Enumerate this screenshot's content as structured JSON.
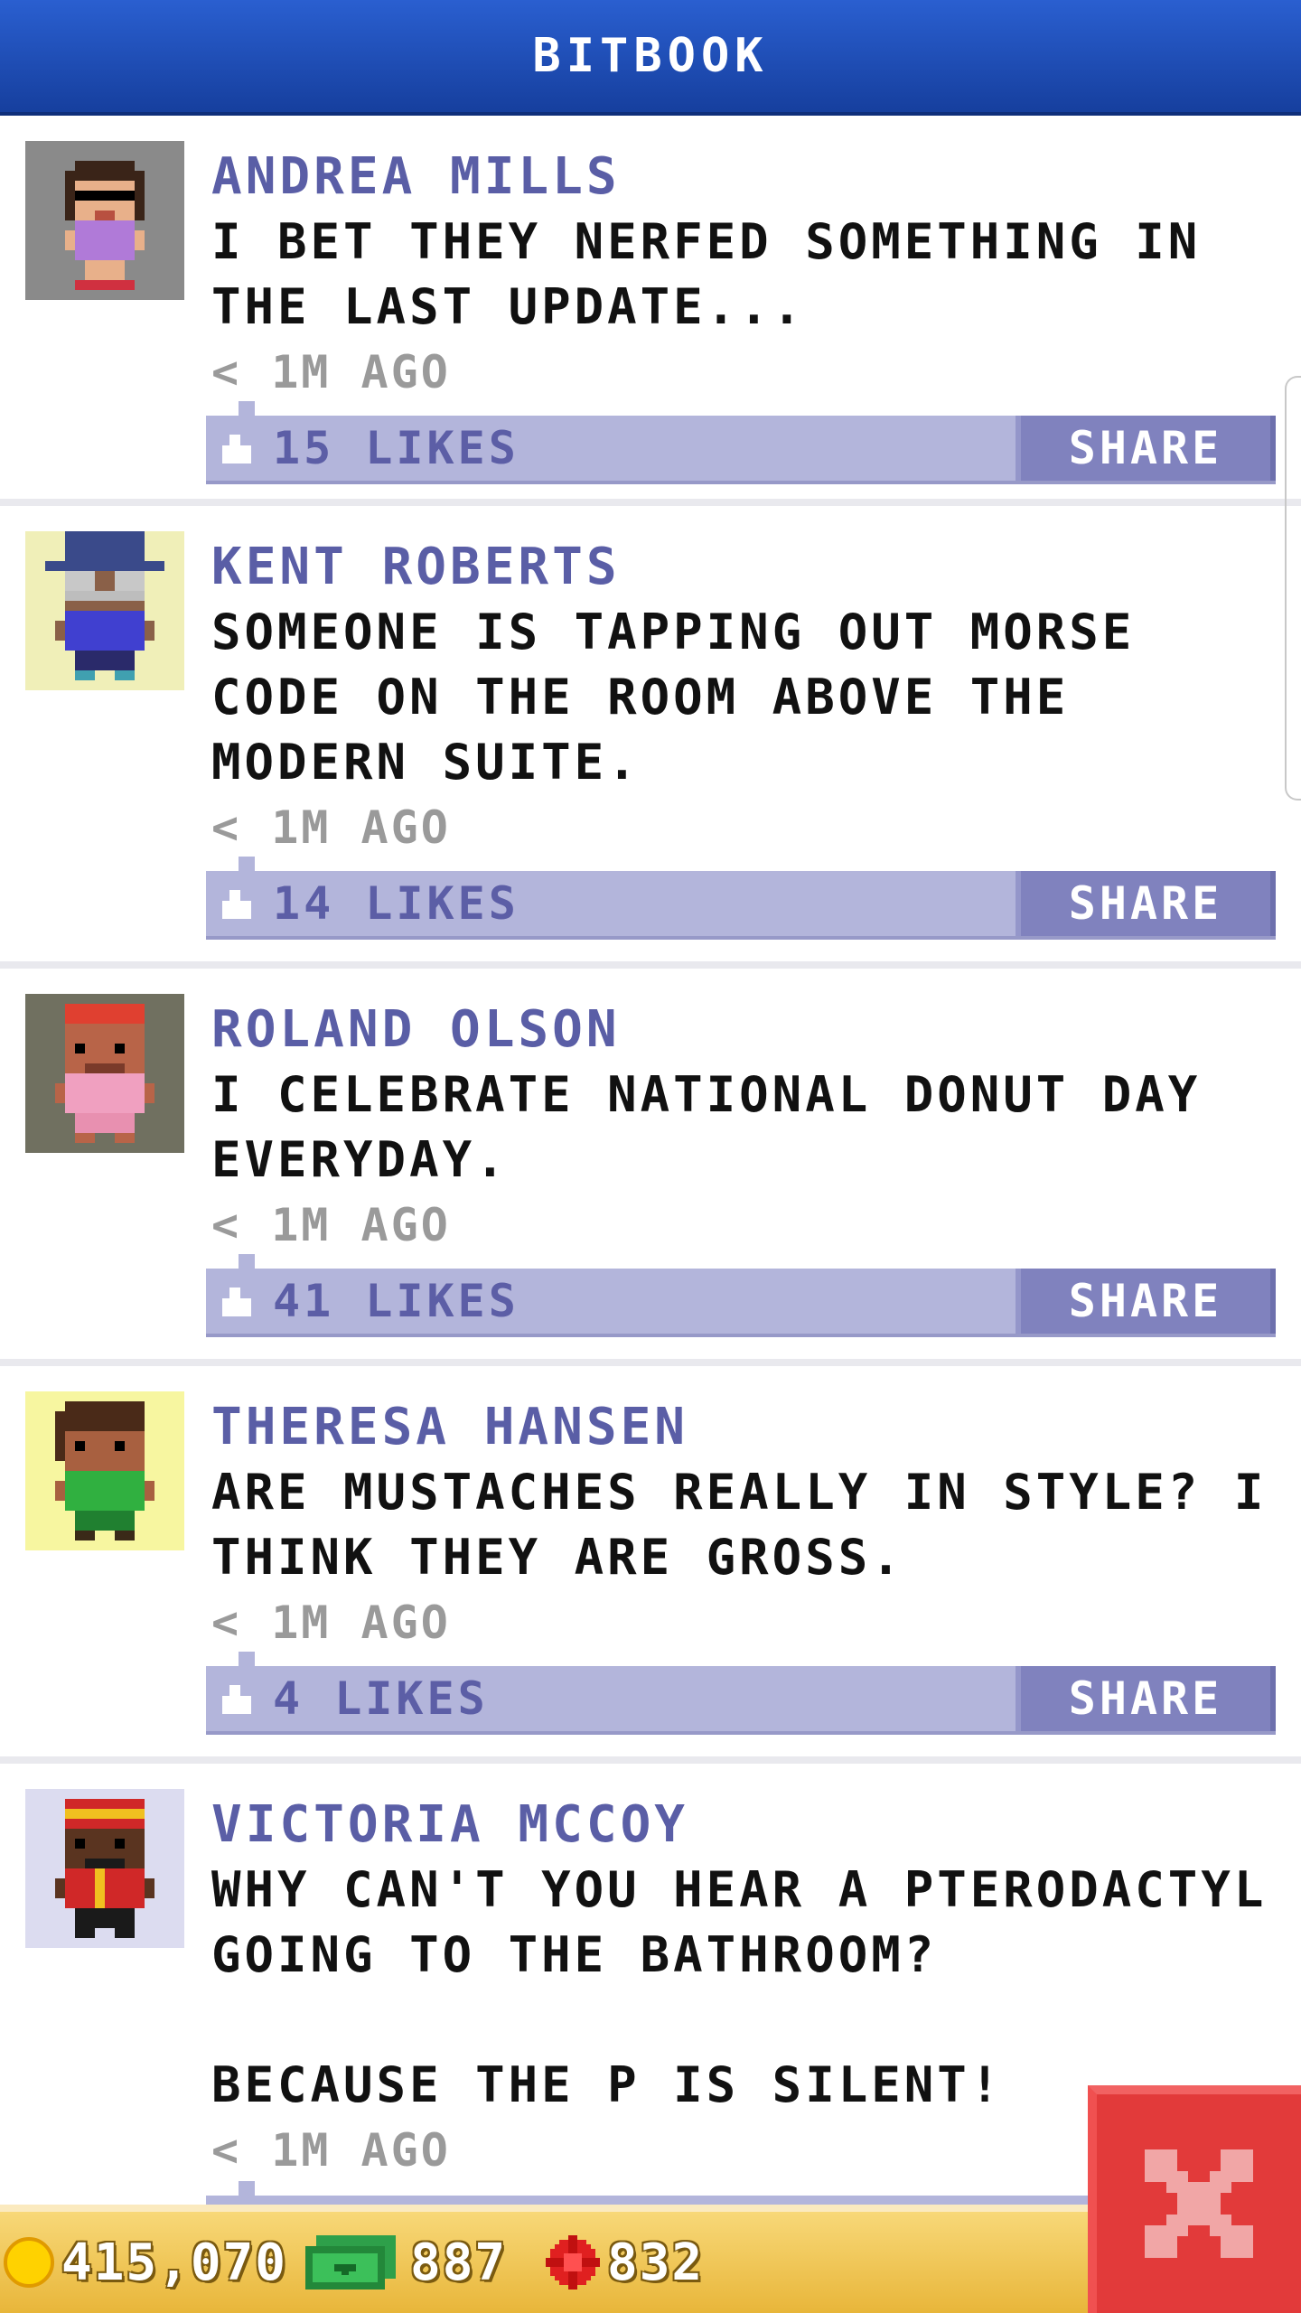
{
  "header": {
    "title": "BITBOOK"
  },
  "posts": [
    {
      "name": "ANDREA MILLS",
      "text": "I BET THEY NERFED SOMETHING IN THE LAST UPDATE...",
      "time": "< 1M AGO",
      "likes": "15 LIKES",
      "share": "SHARE",
      "avatar_bg": "#8a8a8a"
    },
    {
      "name": "KENT ROBERTS",
      "text": "SOMEONE IS TAPPING OUT MORSE CODE ON THE ROOM ABOVE THE MODERN SUITE.",
      "time": "< 1M AGO",
      "likes": "14 LIKES",
      "share": "SHARE",
      "avatar_bg": "#f0efb8"
    },
    {
      "name": "ROLAND OLSON",
      "text": "I CELEBRATE NATIONAL DONUT DAY EVERYDAY.",
      "time": "< 1M AGO",
      "likes": "41 LIKES",
      "share": "SHARE",
      "avatar_bg": "#707060"
    },
    {
      "name": "THERESA HANSEN",
      "text": "ARE MUSTACHES REALLY IN STYLE? I THINK THEY ARE GROSS.",
      "time": "< 1M AGO",
      "likes": "4 LIKES",
      "share": "SHARE",
      "avatar_bg": "#f7f6a0"
    },
    {
      "name": "VICTORIA MCCOY",
      "text": "WHY CAN'T YOU HEAR A PTERODACTYL GOING TO THE BATHROOM?\n\nBECAUSE THE P IS SILENT!",
      "time": "< 1M AGO",
      "avatar_bg": "#dcdcf0"
    }
  ],
  "footer": {
    "coins": "415,070",
    "bux": "887",
    "tokens": "832"
  },
  "colors": {
    "header": "#1f4fb8",
    "name": "#5a5ea6",
    "likebar": "#b3b5db",
    "share": "#8082be",
    "footer": "#f0c24f",
    "close": "#e23a3a"
  }
}
